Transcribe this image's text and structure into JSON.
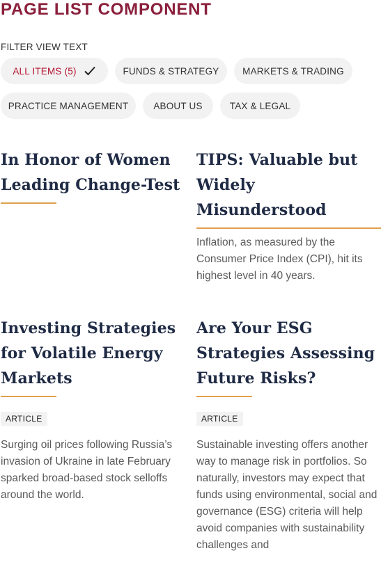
{
  "page": {
    "title": "PAGE LIST COMPONENT",
    "filter_label": "FILTER VIEW TEXT"
  },
  "filters": [
    {
      "label": "ALL ITEMS (5)",
      "active": true,
      "icon": "check-icon"
    },
    {
      "label": "FUNDS & STRATEGY",
      "active": false
    },
    {
      "label": "MARKETS & TRADING",
      "active": false
    },
    {
      "label": "PRACTICE MANAGEMENT",
      "active": false
    },
    {
      "label": "ABOUT US",
      "active": false
    },
    {
      "label": "TAX & LEGAL",
      "active": false
    }
  ],
  "cards": [
    {
      "title_lines": [
        "In Honor of Women",
        "Leading Change-Test"
      ],
      "badge": "",
      "description": ""
    },
    {
      "title_lines": [
        "TIPS: Valuable but",
        "Widely",
        "Misunderstood"
      ],
      "badge": "",
      "description": "Inflation, as measured by the Consumer Price Index (CPI), hit its highest level in 40 years."
    },
    {
      "title_lines": [
        "Investing Strategies",
        "for Volatile Energy",
        "Markets"
      ],
      "badge": "ARTICLE",
      "description": "Surging oil prices following Russia’s invasion of Ukraine in late February sparked broad-based stock selloffs around the world."
    },
    {
      "title_lines": [
        "Are Your ESG",
        "Strategies Assessing",
        "Future Risks?"
      ],
      "badge": "ARTICLE",
      "description": "Sustainable investing offers another way to manage risk in portfolios. So naturally, investors may expect that funds using environmental, social and governance (ESG) criteria will help avoid companies with sustainability challenges and"
    }
  ],
  "colors": {
    "title": "#8a1f3b",
    "active_chip_text": "#b4102d",
    "accent_line": "#e0a04c",
    "chip_bg": "#f2f2f2",
    "heading": "#1f2a44"
  }
}
